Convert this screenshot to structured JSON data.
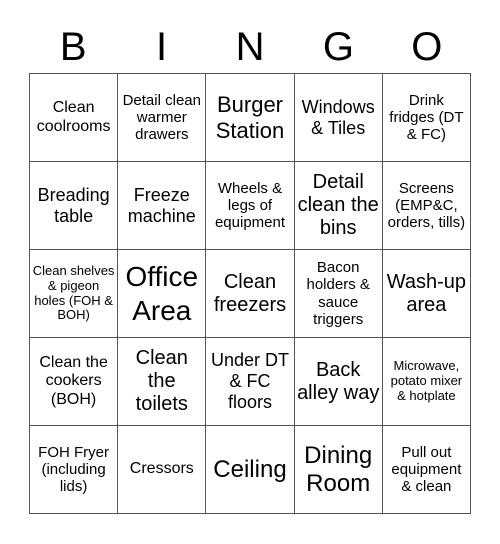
{
  "header": {
    "letters": [
      "B",
      "I",
      "N",
      "G",
      "O"
    ]
  },
  "cells": [
    "Clean coolrooms",
    "Detail clean warmer drawers",
    "Burger Station",
    "Windows & Tiles",
    "Drink fridges (DT & FC)",
    "Breading table",
    "Freeze machine",
    "Wheels & legs of equipment",
    "Detail clean the bins",
    "Screens (EMP&C, orders, tills)",
    "Clean shelves & pigeon holes (FOH & BOH)",
    "Office Area",
    "Clean freezers",
    "Bacon holders & sauce triggers",
    "Wash-up area",
    "Clean the cookers (BOH)",
    "Clean the toilets",
    "Under DT & FC floors",
    "Back alley way",
    "Microwave, potato mixer & hotplate",
    "FOH Fryer (including lids)",
    "Cressors",
    "Ceiling",
    "Dining Room",
    "Pull out equipment & clean"
  ]
}
